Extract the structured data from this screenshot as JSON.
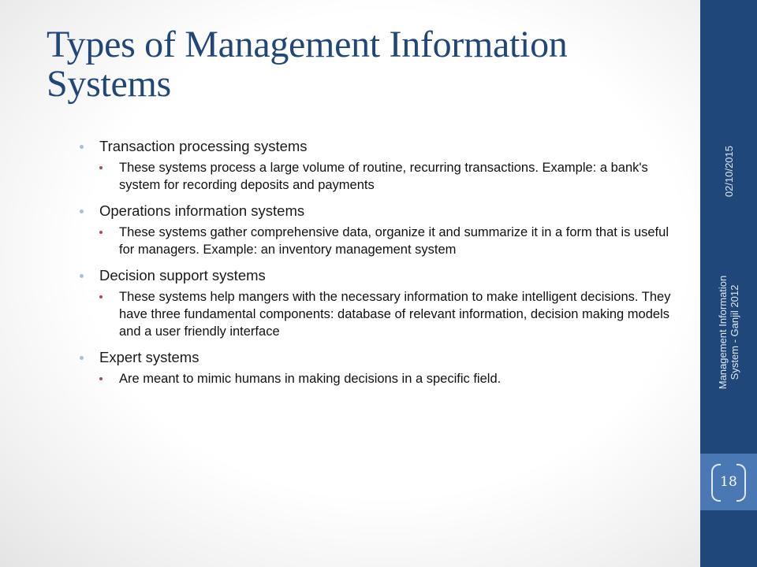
{
  "slide": {
    "title": "Types of Management Information Systems",
    "items": [
      {
        "heading": "Transaction processing systems",
        "detail": "These systems process a large volume of routine, recurring transactions. Example: a bank's system for recording deposits and payments"
      },
      {
        "heading": "Operations information systems",
        "detail": "These systems gather comprehensive data, organize it and summarize it in a form that is useful for managers. Example: an inventory management system"
      },
      {
        "heading": "Decision support systems",
        "detail": "These systems help mangers with the necessary information to make intelligent decisions. They have three fundamental components: database of relevant information, decision making models and a user friendly interface"
      },
      {
        "heading": "Expert systems",
        "detail": "Are meant to mimic humans in making decisions in a specific field."
      }
    ]
  },
  "sidebar": {
    "footer_line1": "Management Information",
    "footer_line2": "System - Ganjil 2012",
    "date": "02/10/2015",
    "page_number": "18"
  },
  "colors": {
    "title": "#1f477a",
    "sidebar": "#1f477a",
    "page_band": "#4a78b4",
    "sub_bullet": "#b14a4a"
  }
}
